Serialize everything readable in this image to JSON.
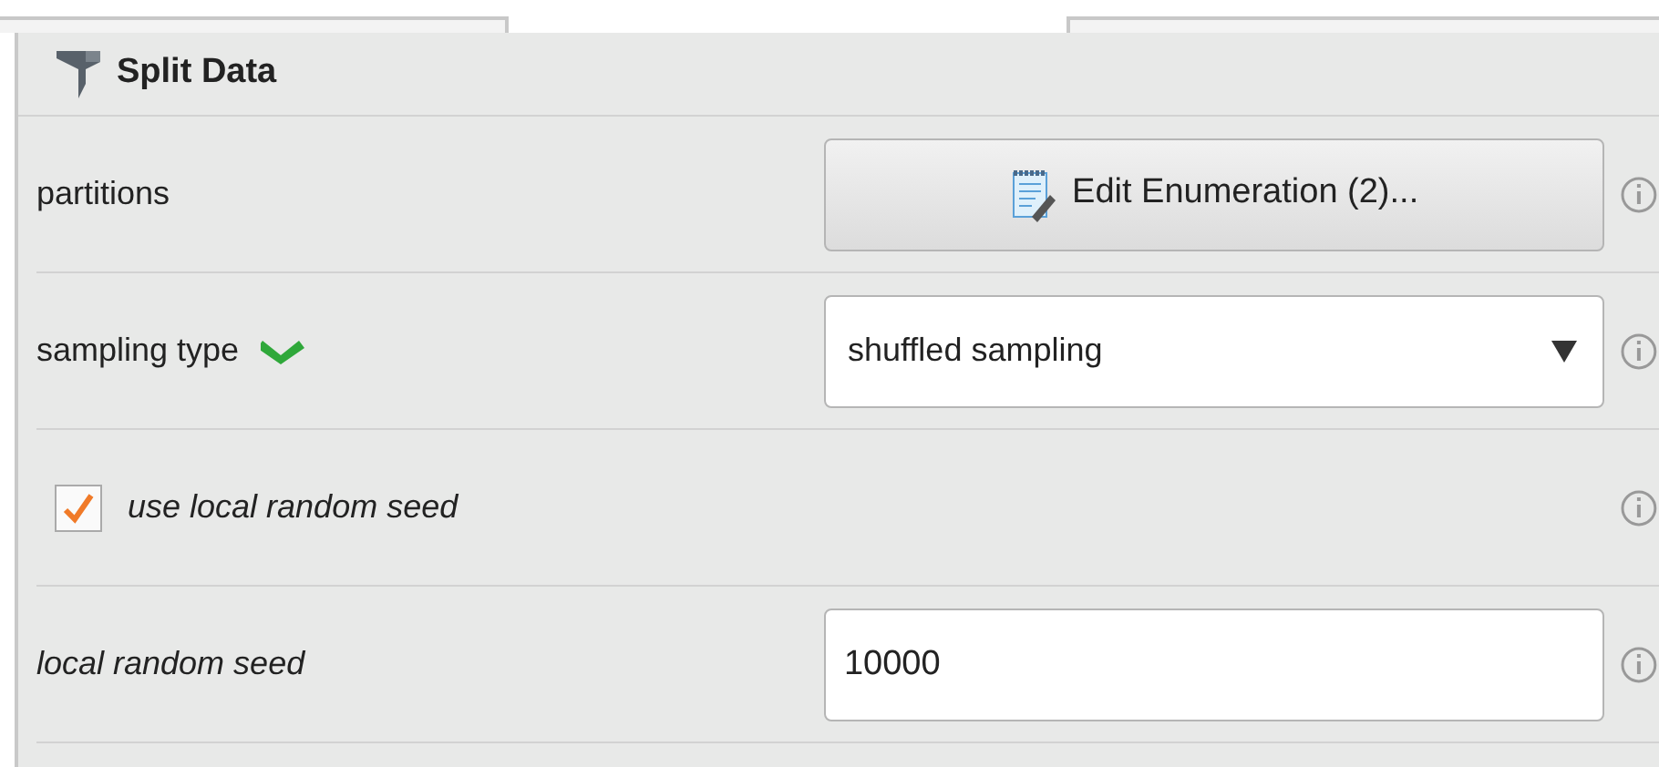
{
  "panel": {
    "title": "Split Data"
  },
  "parameters": [
    {
      "kind": "button",
      "label": "partitions",
      "expert": false,
      "marked": false,
      "value": "Edit Enumeration (2)..."
    },
    {
      "kind": "select",
      "label": "sampling type",
      "expert": false,
      "marked": true,
      "value": "shuffled sampling"
    },
    {
      "kind": "checkbox",
      "label": "use local random seed",
      "expert": true,
      "marked": false,
      "checked": true
    },
    {
      "kind": "input",
      "label": "local random seed",
      "expert": true,
      "marked": false,
      "value": "10000"
    }
  ]
}
